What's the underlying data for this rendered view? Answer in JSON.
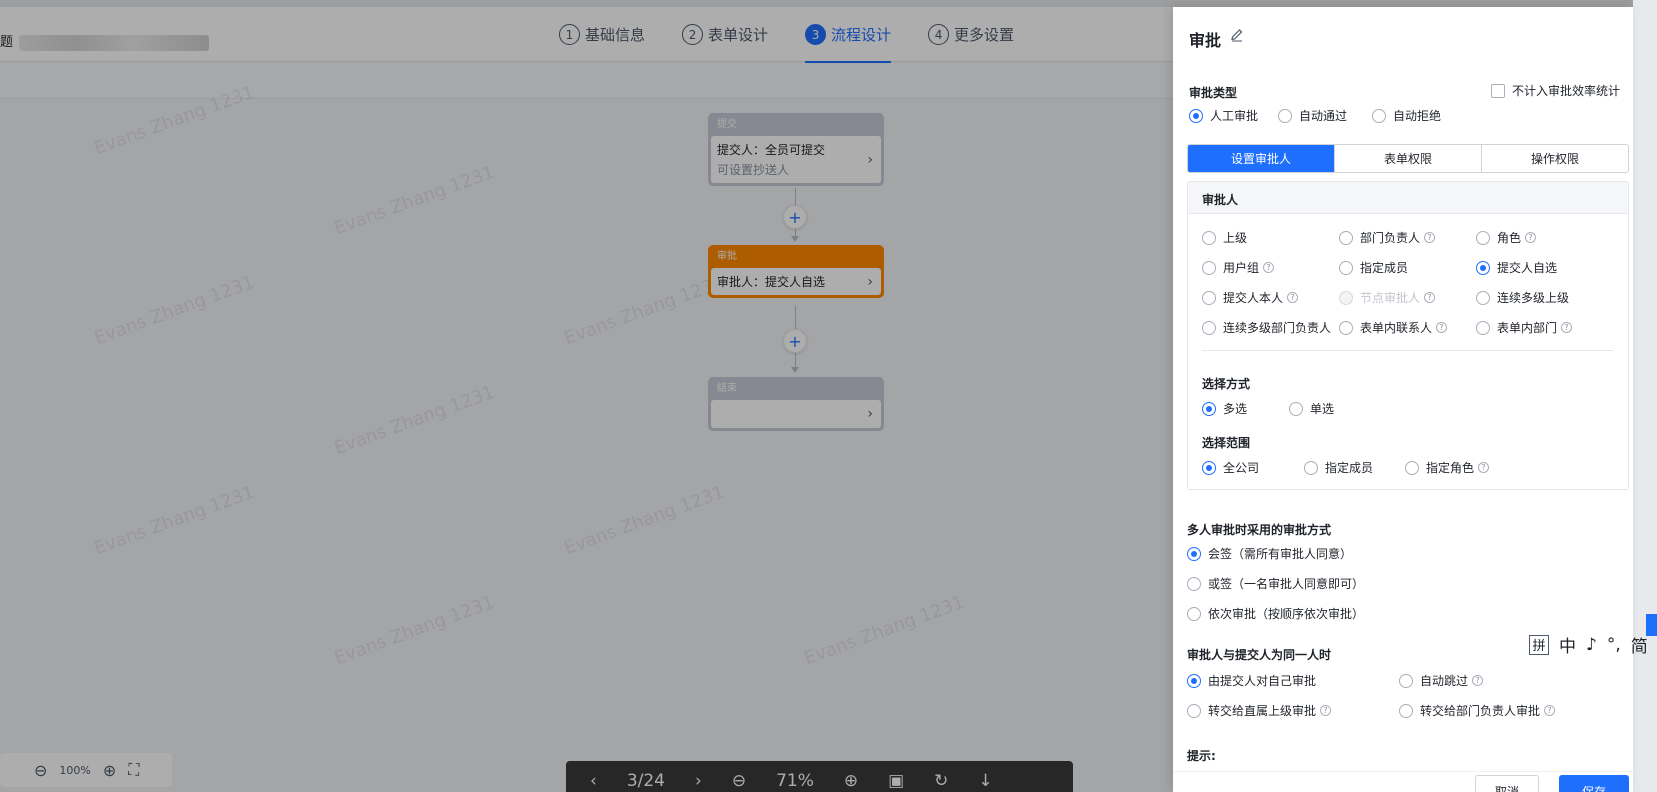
{
  "app": {
    "doc_title": "题",
    "steps": [
      {
        "num": "1",
        "label": "基础信息"
      },
      {
        "num": "2",
        "label": "表单设计"
      },
      {
        "num": "3",
        "label": "流程设计"
      },
      {
        "num": "4",
        "label": "更多设置"
      }
    ],
    "active_step": 2,
    "watermark": "Evans Zhang 1231"
  },
  "flow": {
    "submit": {
      "head": "提交",
      "line1": "提交人：全员可提交",
      "line2": "可设置抄送人"
    },
    "approve": {
      "head": "审批",
      "line1": "审批人：提交人自选"
    },
    "end": {
      "head": "结束"
    }
  },
  "zoom": {
    "value": "100%"
  },
  "pager": {
    "page": "3/24",
    "zoom": "71%"
  },
  "drawer": {
    "title": "审批",
    "approval_type": {
      "label": "审批类型",
      "options": [
        "人工审批",
        "自动通过",
        "自动拒绝"
      ],
      "selected": 0,
      "exclude_checkbox": "不计入审批效率统计"
    },
    "tabs": [
      "设置审批人",
      "表单权限",
      "操作权限"
    ],
    "approver": {
      "heading": "审批人",
      "options": [
        {
          "label": "上级",
          "help": false
        },
        {
          "label": "部门负责人",
          "help": true
        },
        {
          "label": "角色",
          "help": true
        },
        {
          "label": "用户组",
          "help": true
        },
        {
          "label": "指定成员",
          "help": false
        },
        {
          "label": "提交人自选",
          "help": false,
          "selected": true
        },
        {
          "label": "提交人本人",
          "help": true
        },
        {
          "label": "节点审批人",
          "help": true,
          "disabled": true
        },
        {
          "label": "连续多级上级",
          "help": false
        },
        {
          "label": "连续多级部门负责人",
          "help": false
        },
        {
          "label": "表单内联系人",
          "help": true
        },
        {
          "label": "表单内部门",
          "help": true
        }
      ]
    },
    "select_mode": {
      "label": "选择方式",
      "options": [
        "多选",
        "单选"
      ],
      "selected": 0
    },
    "select_scope": {
      "label": "选择范围",
      "options": [
        "全公司",
        "指定成员",
        "指定角色"
      ],
      "selected": 0
    },
    "multi_mode": {
      "label": "多人审批时采用的审批方式",
      "options": [
        "会签（需所有审批人同意）",
        "或签（一名审批人同意即可）",
        "依次审批（按顺序依次审批）"
      ],
      "selected": 0
    },
    "same_person": {
      "label": "审批人与提交人为同一人时",
      "options": [
        "由提交人对自己审批",
        "自动跳过",
        "转交给直属上级审批",
        "转交给部门负责人审批"
      ],
      "selected": 0
    },
    "tip_label": "提示:",
    "cancel": "取消",
    "save": "保存"
  },
  "ime_toolbar": {
    "items": [
      "拼",
      "中",
      "♪",
      "°,",
      "简"
    ]
  },
  "colors": {
    "primary": "#1f6fff",
    "approve_node": "#ff8800",
    "node_gray": "#c6cbd6"
  }
}
